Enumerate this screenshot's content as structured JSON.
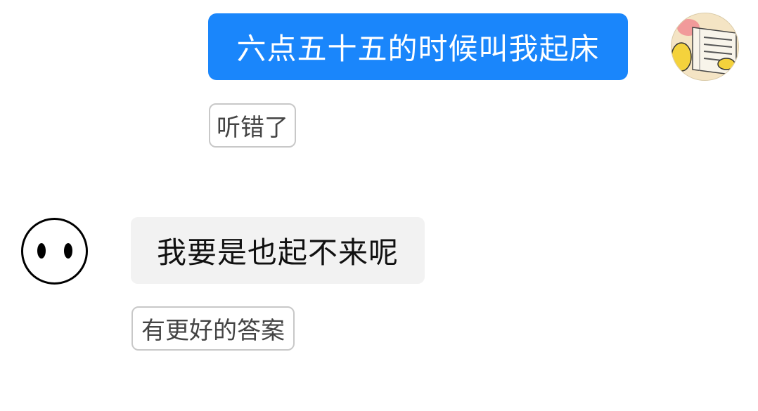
{
  "messages": [
    {
      "sender": "user",
      "text": "六点五十五的时候叫我起床",
      "avatar": "book-reader-avatar",
      "feedback_chip": "听错了"
    },
    {
      "sender": "assistant",
      "text": "我要是也起不来呢",
      "avatar": "two-dot-face-avatar",
      "feedback_chip": "有更好的答案"
    }
  ],
  "colors": {
    "user_bubble": "#1a86fb",
    "assistant_bubble": "#f2f2f2",
    "chip_border": "#c8c8c8"
  }
}
